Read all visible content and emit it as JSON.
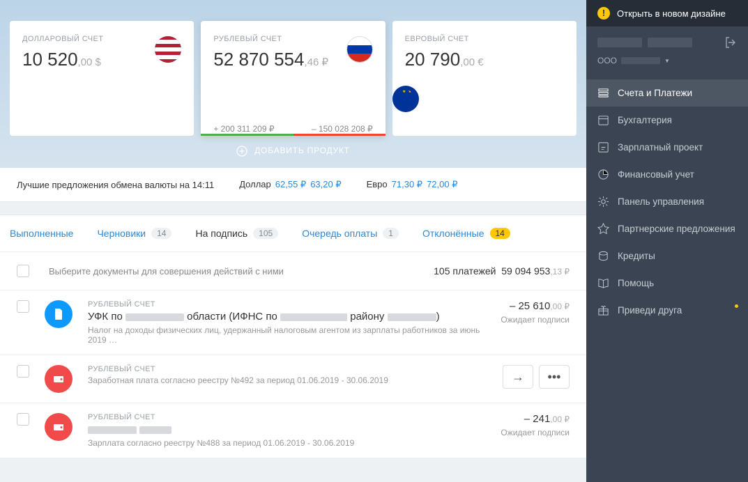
{
  "accounts": [
    {
      "label": "ДОЛЛАРОВЫЙ СЧЕТ",
      "int": "10 520",
      "dec": ",00 $"
    },
    {
      "label": "РУБЛЕВЫЙ СЧЕТ",
      "int": "52 870 554",
      "dec": ",46 ₽",
      "in": "+ 200 311 209 ₽",
      "out": "– 150 028 208 ₽"
    },
    {
      "label": "ЕВРОВЫЙ СЧЕТ",
      "int": "20 790",
      "dec": ",00 €"
    }
  ],
  "add_product": "ДОБАВИТЬ ПРОДУКТ",
  "rates": {
    "label": "Лучшие предложения обмена валюты на 14:11",
    "usd_label": "Доллар",
    "usd_buy": "62,55 ₽",
    "usd_sell": "63,20 ₽",
    "eur_label": "Евро",
    "eur_buy": "71,30 ₽",
    "eur_sell": "72,00 ₽"
  },
  "tabs": {
    "done": "Выполненные",
    "drafts": "Черновики",
    "drafts_n": "14",
    "sign": "На подпись",
    "sign_n": "105",
    "queue": "Очередь оплаты",
    "queue_n": "1",
    "rejected": "Отклонённые",
    "rejected_n": "14"
  },
  "list_head": {
    "hint": "Выберите документы для совершения действий с ними",
    "count": "105 платежей",
    "sum_int": "59 094 953",
    "sum_dec": ",13 ₽"
  },
  "items": [
    {
      "acct": "РУБЛЕВЫЙ СЧЕТ",
      "title_pre": "УФК по ",
      "title_mid": " области (ИФНС по ",
      "title_post": " району ",
      "title_end": ")",
      "desc": "Налог на доходы физических лиц, удержанный налоговым агентом из зарплаты работников за июнь 2019 …",
      "amount_int": "– 25 610",
      "amount_dec": ",00 ₽",
      "status": "Ожидает подписи"
    },
    {
      "acct": "РУБЛЕВЫЙ СЧЕТ",
      "desc": "Заработная плата согласно реестру №492 за период 01.06.2019 - 30.06.2019"
    },
    {
      "acct": "РУБЛЕВЫЙ СЧЕТ",
      "desc": "Зарплата согласно реестру №488 за период 01.06.2019 - 30.06.2019",
      "amount_int": "– 241",
      "amount_dec": ",00 ₽",
      "status": "Ожидает подписи"
    }
  ],
  "banner": "Открыть в новом дизайне",
  "company_prefix": "ООО",
  "nav": {
    "accounts": "Счета и Платежи",
    "accounting": "Бухгалтерия",
    "payroll": "Зарплатный проект",
    "finance": "Финансовый учет",
    "panel": "Панель управления",
    "partner": "Партнерские предложения",
    "credits": "Кредиты",
    "help": "Помощь",
    "refer": "Приведи друга"
  }
}
